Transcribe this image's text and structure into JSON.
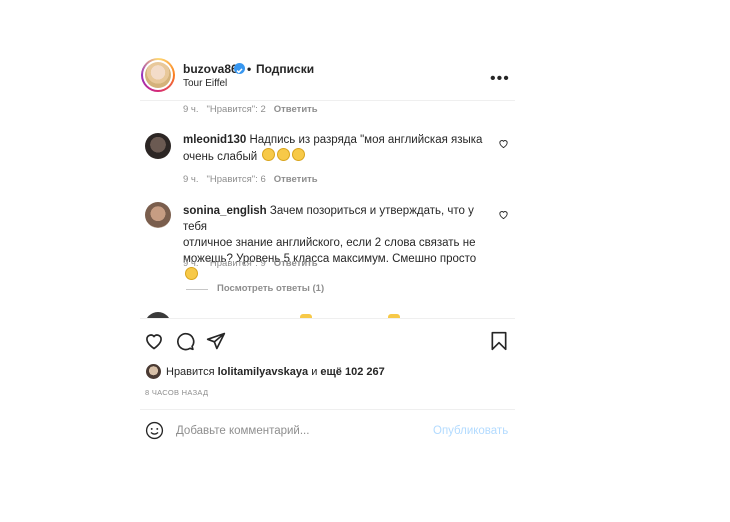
{
  "header": {
    "username": "buzova86",
    "separator": "•",
    "follow_label": "Подписки",
    "location": "Tour Eiffel",
    "more_label": "•••"
  },
  "comments": [
    {
      "meta": {
        "time": "9 ч.",
        "likes": "\"Нравится\": 2",
        "reply": "Ответить"
      }
    },
    {
      "username": "mleonid130",
      "text_line1": "Надпись из разряда \"моя английская языка",
      "text_line2": "очень слабый",
      "meta": {
        "time": "9 ч.",
        "likes": "\"Нравится\": 6",
        "reply": "Ответить"
      }
    },
    {
      "username": "sonina_english",
      "text_line1": "Зачем позориться и утверждать, что у тебя",
      "text_line2": "отличное знание английского, если 2 слова связать не",
      "text_line3": "можешь? Уровень 5 класса максимум. Смешно просто",
      "meta": {
        "time": "9 ч.",
        "likes": "\"Нравится\": 9",
        "reply": "Ответить"
      },
      "view_replies": "Посмотреть ответы (1)"
    }
  ],
  "likes_line": {
    "prefix": "Нравится",
    "user": "lolitamilyavskaya",
    "middle": "и",
    "rest": "ещё 102 267"
  },
  "timestamp": "8 ЧАСОВ НАЗАД",
  "comment_input": {
    "placeholder": "Добавьте комментарий...",
    "publish": "Опубликовать"
  }
}
